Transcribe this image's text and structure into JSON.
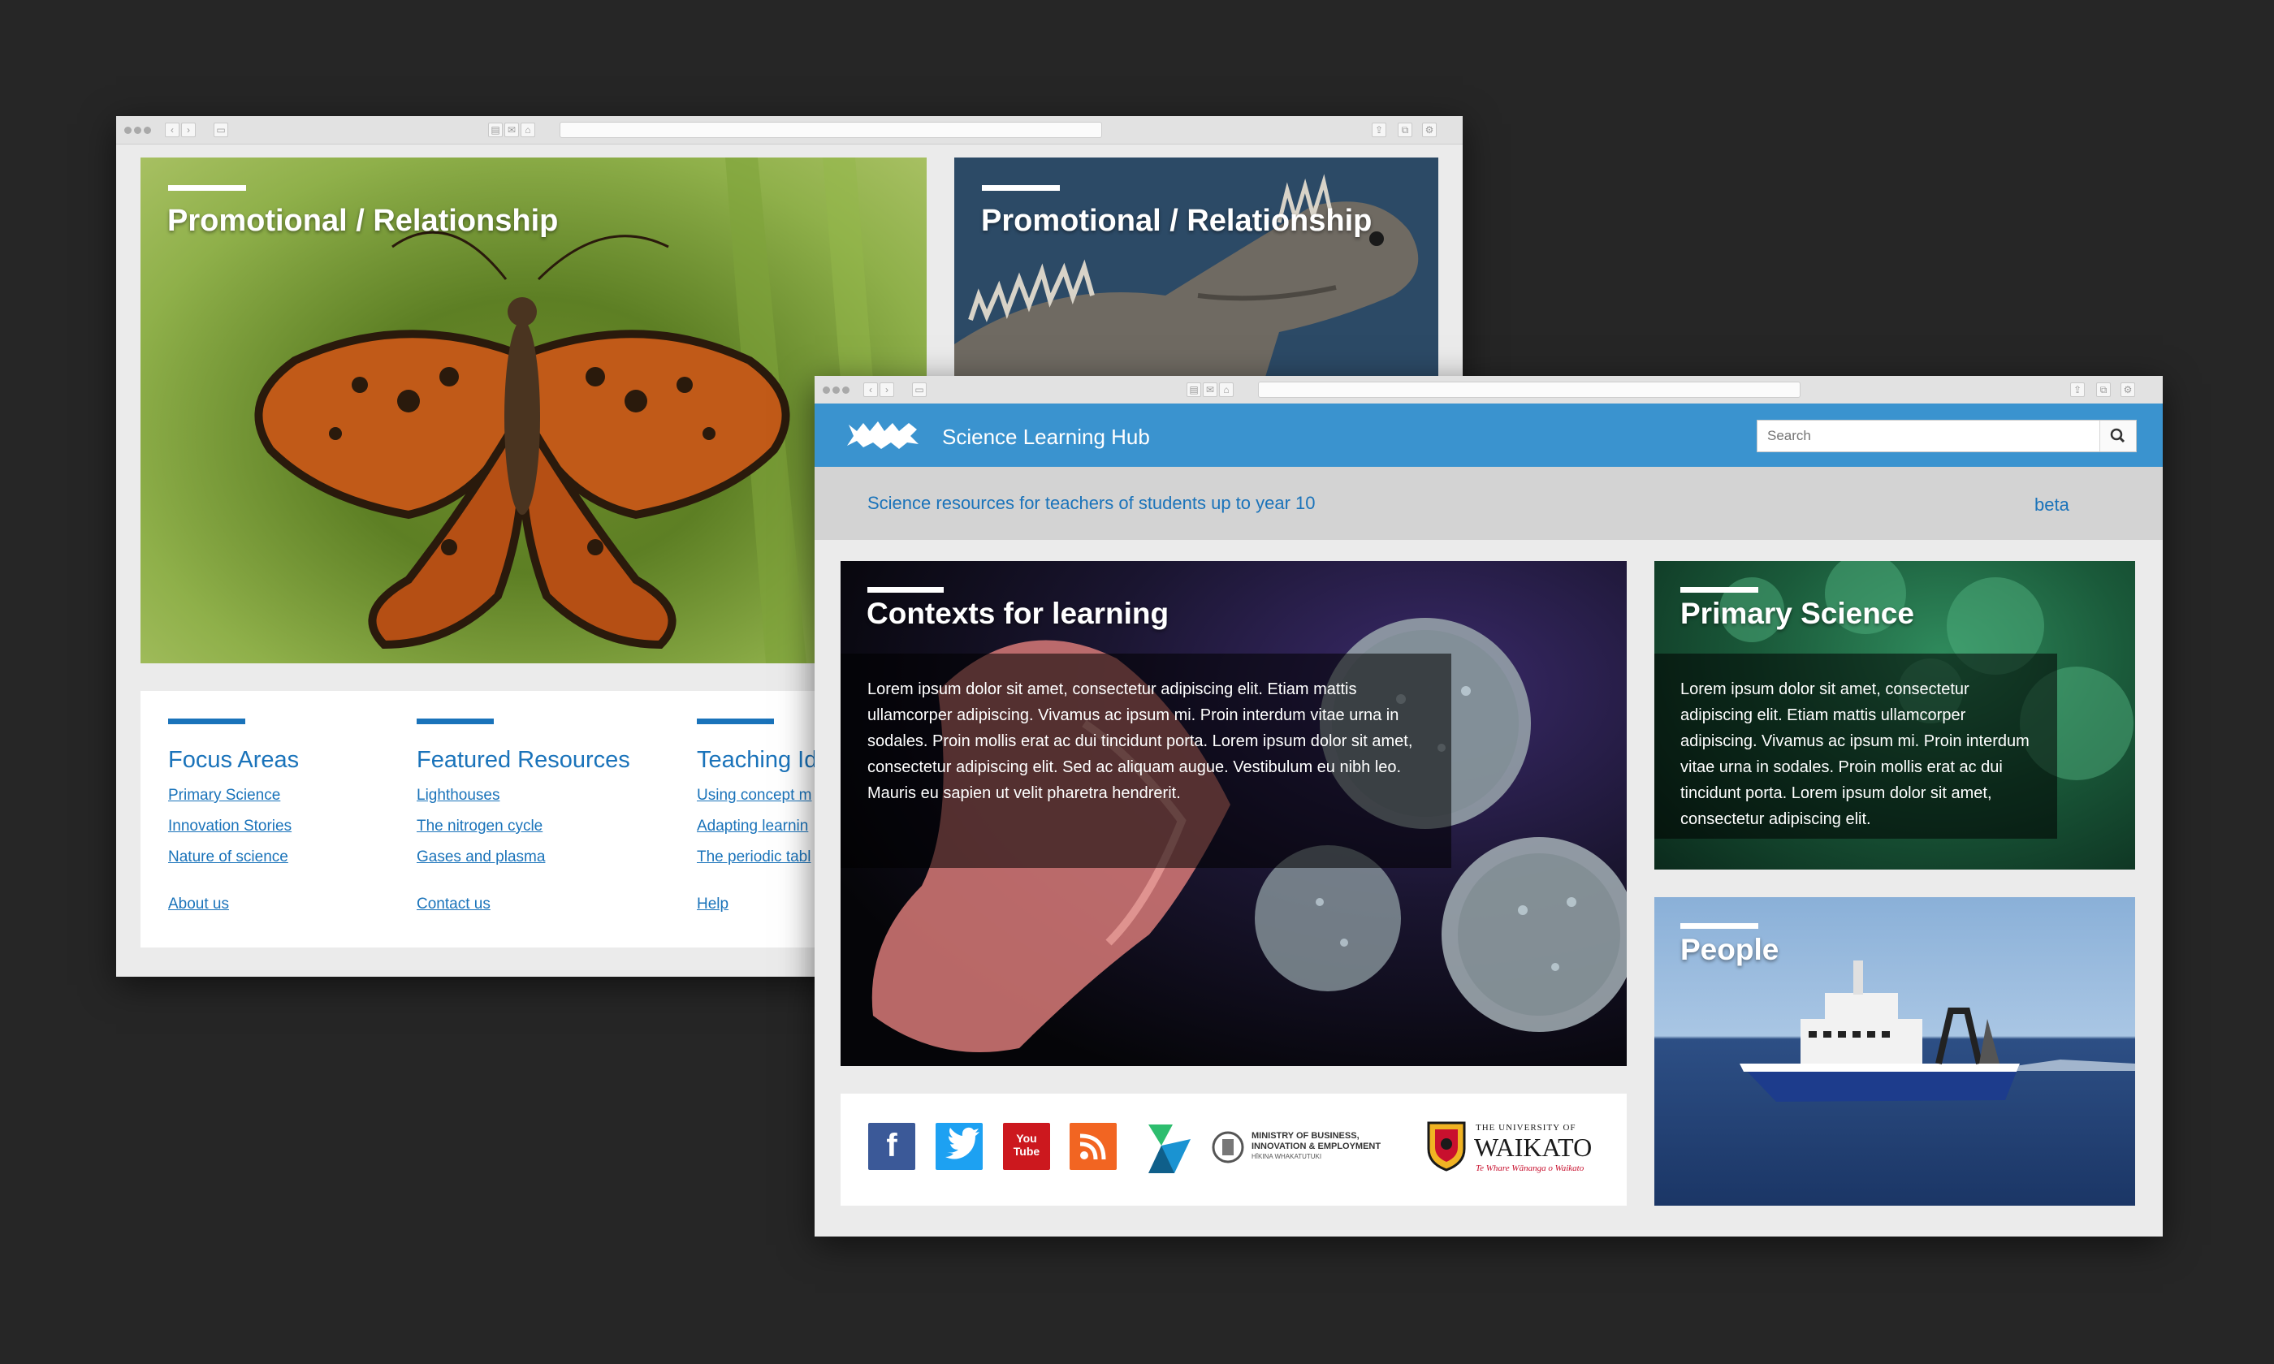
{
  "window_back": {
    "tiles": {
      "butterfly_title": "Promotional / Relationship",
      "tuatara_title": "Promotional / Relationship"
    },
    "columns": [
      {
        "heading": "Focus Areas",
        "links": [
          "Primary Science",
          "Innovation Stories",
          "Nature of science"
        ],
        "bottom": "About us"
      },
      {
        "heading": "Featured Resources",
        "links": [
          "Lighthouses",
          "The nitrogen cycle",
          "Gases and plasma"
        ],
        "bottom": "Contact us"
      },
      {
        "heading": "Teaching Id",
        "links": [
          "Using concept m",
          "Adapting learnin",
          "The periodic tabl"
        ],
        "bottom": "Help"
      }
    ]
  },
  "window_front": {
    "site_title": "Science Learning Hub",
    "search": {
      "placeholder": "Search"
    },
    "tagline": "Science resources for teachers of students up to year 10",
    "beta": "beta",
    "contexts": {
      "title": "Contexts for learning",
      "body": "Lorem ipsum dolor sit amet, consectetur adipiscing elit. Etiam mattis ullamcorper adipiscing. Vivamus ac ipsum mi. Proin interdum vitae urna in sodales. Proin mollis erat ac dui tincidunt porta. Lorem ipsum dolor sit amet, consectetur adipiscing elit. Sed ac aliquam augue. Vestibulum eu nibh leo. Mauris eu sapien ut velit pharetra hendrerit."
    },
    "primary_science": {
      "title": "Primary Science",
      "body": "Lorem ipsum dolor sit amet, consectetur adipiscing elit. Etiam mattis ullamcorper adipiscing. Vivamus ac ipsum mi. Proin interdum vitae urna in sodales. Proin mollis erat ac dui tincidunt porta. Lorem ipsum dolor sit amet, consectetur adipiscing elit."
    },
    "people": {
      "title": "People"
    },
    "footer": {
      "social": [
        {
          "icon": "facebook-icon",
          "glyph": "f",
          "color": "#3b5998"
        },
        {
          "icon": "twitter-icon",
          "glyph": "t",
          "color": "#1da1f2"
        },
        {
          "icon": "youtube-icon",
          "glyph": "You Tube",
          "color": "#cc181e"
        },
        {
          "icon": "rss-icon",
          "glyph": "rss",
          "color": "#f26522"
        }
      ],
      "mbie": {
        "line1": "MINISTRY OF BUSINESS,",
        "line2": "INNOVATION & EMPLOYMENT",
        "line3": "HĪKINA WHAKATUTUKI"
      },
      "waikato": {
        "line1": "THE UNIVERSITY OF",
        "line2": "WAIKATO",
        "line3": "Te Whare Wānanga o Waikato"
      }
    }
  },
  "colors": {
    "background": "#262626",
    "header_blue": "#3a93cf",
    "link_blue": "#1a73ba",
    "tagline_bg": "#d3d3d3"
  }
}
